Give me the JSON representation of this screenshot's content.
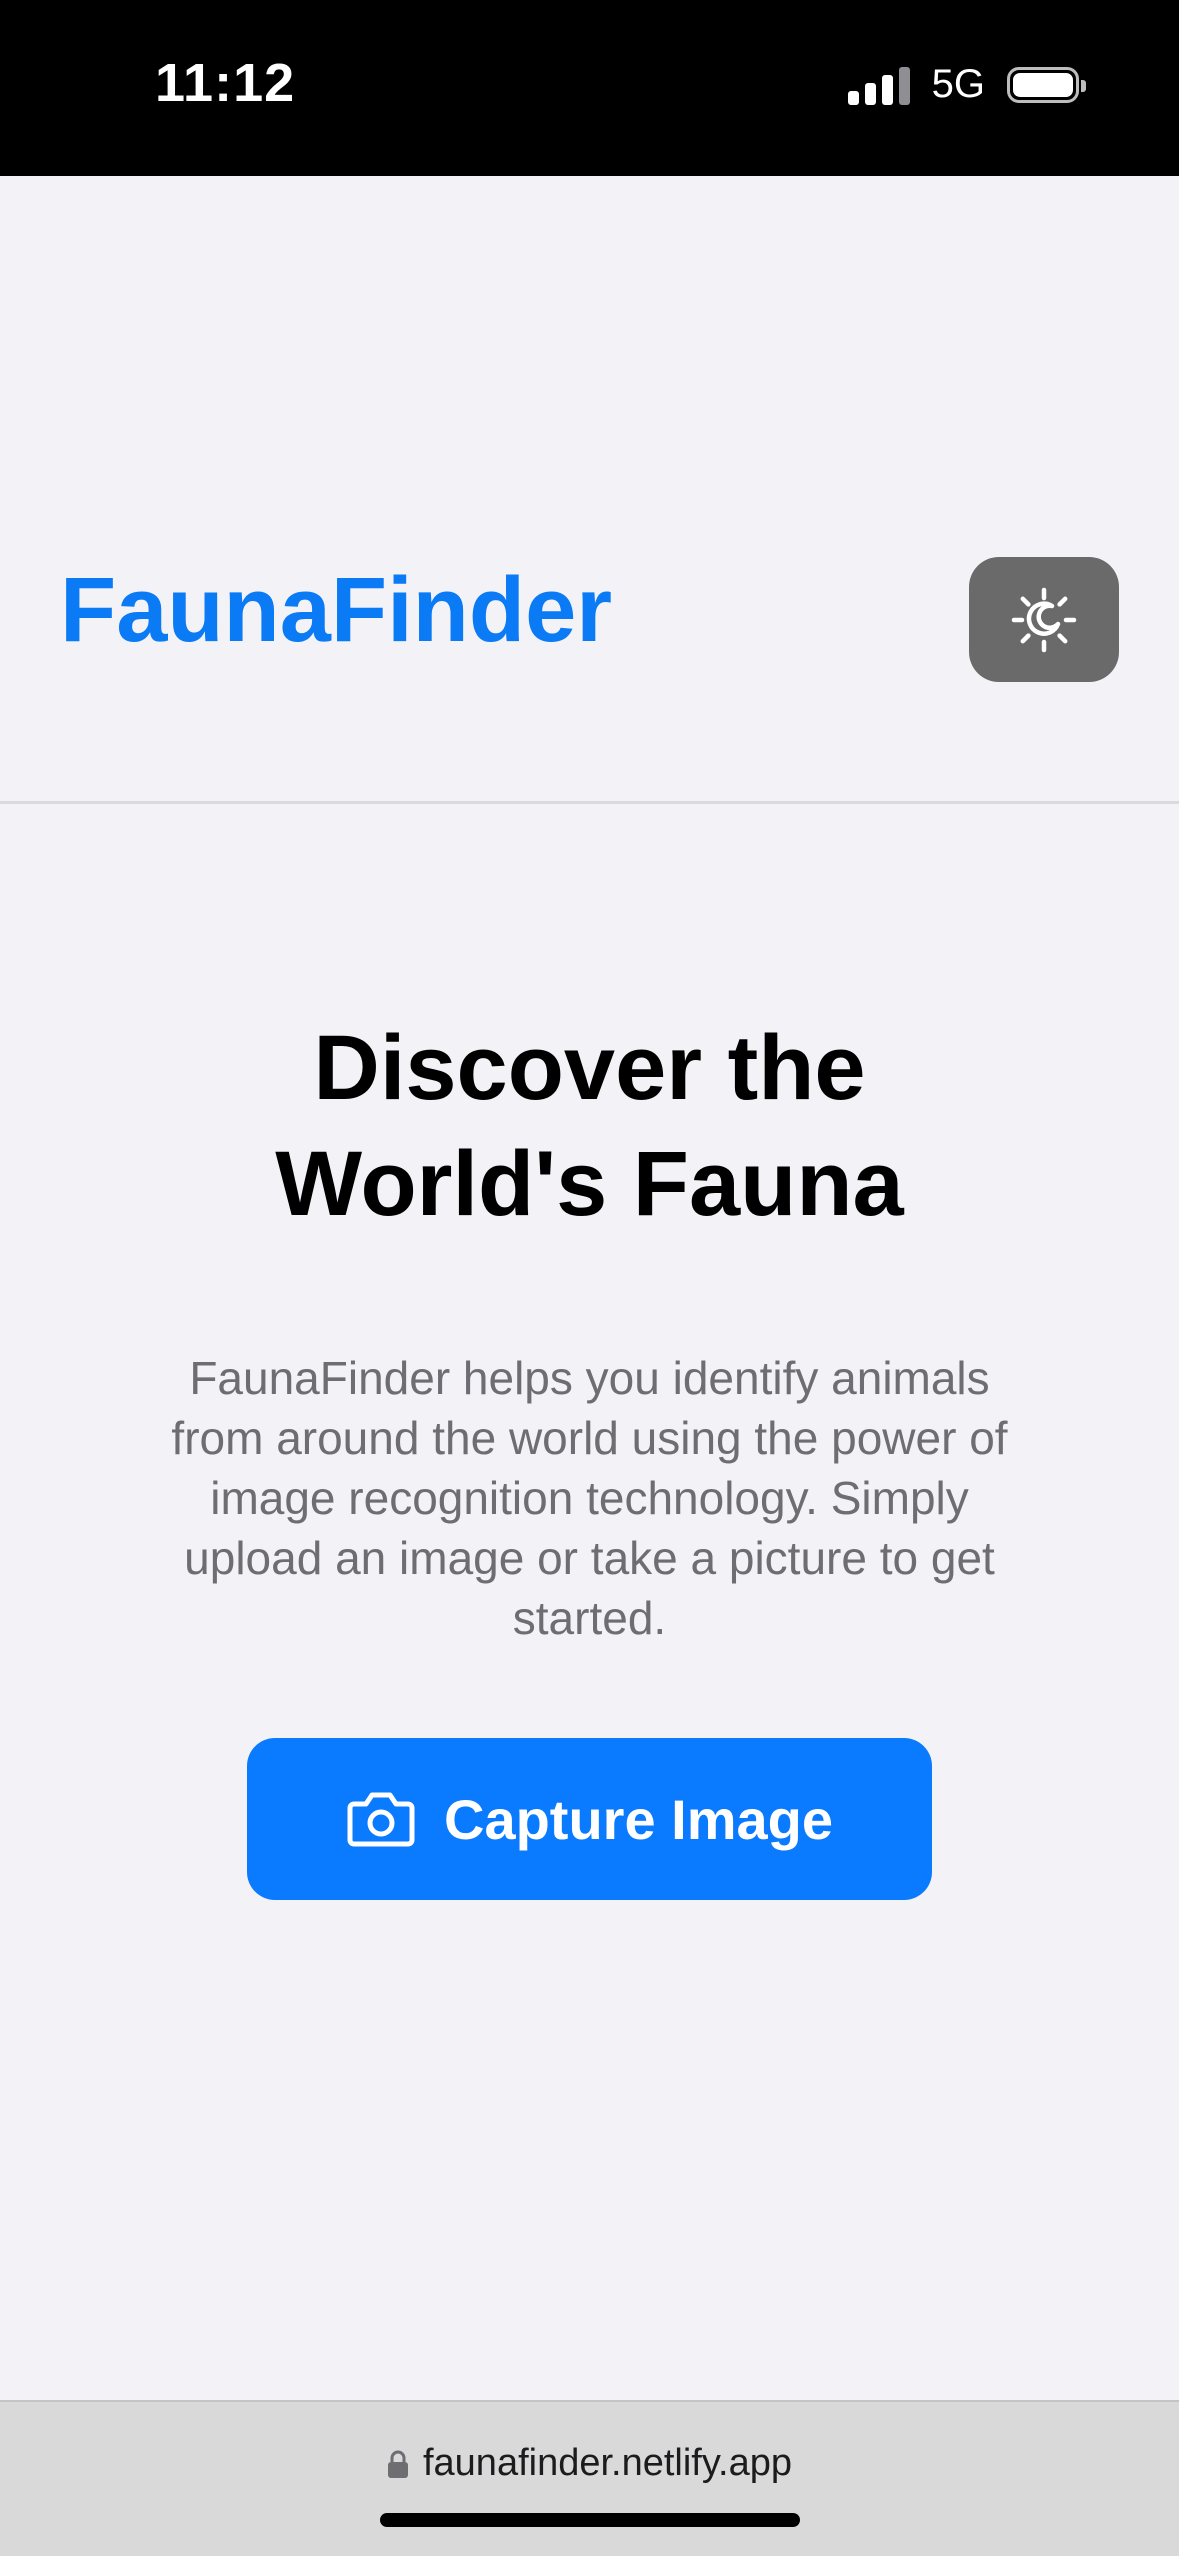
{
  "status_bar": {
    "time": "11:12",
    "network": "5G",
    "battery_level": 1.0
  },
  "header": {
    "brand": "FaunaFinder",
    "theme_toggle_icon": "sun-moon-icon"
  },
  "hero": {
    "title_line1": "Discover the",
    "title_line2": "World's Fauna",
    "description": "FaunaFinder helps you identify animals from around the world using the power of image recognition technology. Simply upload an image or take a picture to get started.",
    "capture_button": {
      "label": "Capture Image",
      "icon": "camera-icon"
    }
  },
  "browser": {
    "url": "faunafinder.netlify.app",
    "lock_icon": "lock-icon"
  },
  "colors": {
    "accent": "#0a7aff",
    "brand": "#0a7af5",
    "background": "#f2f2f7",
    "toggle_bg": "#6a6a6a"
  }
}
